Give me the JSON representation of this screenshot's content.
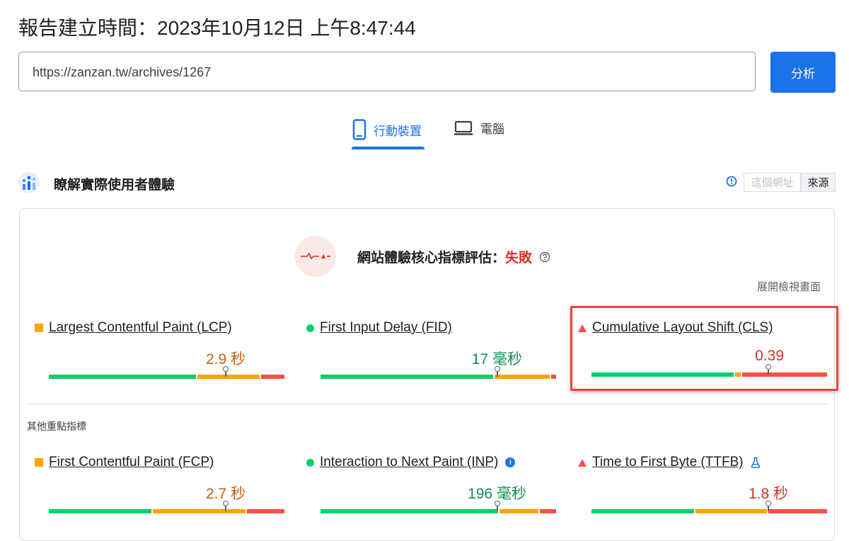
{
  "header": {
    "report_time": "報告建立時間：2023年10月12日 上午8:47:44"
  },
  "url_input": {
    "value": "https://zanzan.tw/archives/1267"
  },
  "analyze_button": {
    "label": "分析"
  },
  "device_tabs": [
    {
      "label": "行動裝置",
      "icon": "smartphone-icon",
      "active": true
    },
    {
      "label": "電腦",
      "icon": "laptop-icon",
      "active": false
    }
  ],
  "crux": {
    "title": "瞭解實際使用者體驗",
    "source_url_label": "這個網址",
    "source_origin_label": "來源"
  },
  "assessment": {
    "label": "網站體驗核心指標評估：",
    "result": "失敗",
    "expand_label": "展開檢視畫面"
  },
  "core_metrics": [
    {
      "name": "Largest Contentful Paint (LCP)",
      "value": "2.9 秒",
      "rating": "needs-improvement"
    },
    {
      "name": "First Input Delay (FID)",
      "value": "17 毫秒",
      "rating": "good"
    },
    {
      "name": "Cumulative Layout Shift (CLS)",
      "value": "0.39",
      "rating": "poor"
    }
  ],
  "other_section": {
    "title": "其他重點指標"
  },
  "other_metrics": [
    {
      "name": "First Contentful Paint (FCP)",
      "value": "2.7 秒",
      "rating": "needs-improvement"
    },
    {
      "name": "Interaction to Next Paint (INP)",
      "value": "196 毫秒",
      "rating": "good",
      "badge": "info-icon"
    },
    {
      "name": "Time to First Byte (TTFB)",
      "value": "1.8 秒",
      "rating": "poor",
      "badge": "flask-icon"
    }
  ],
  "distributions": {
    "lcp": {
      "good": 0.63,
      "needs_improvement": 0.27,
      "poor": 0.1,
      "marker": 0.75
    },
    "fid": {
      "good": 0.74,
      "needs_improvement": 0.24,
      "poor": 0.02,
      "marker": 0.75
    },
    "cls": {
      "good": 0.61,
      "needs_improvement": 0.03,
      "poor": 0.36,
      "marker": 0.75
    },
    "fcp": {
      "good": 0.44,
      "needs_improvement": 0.4,
      "poor": 0.16,
      "marker": 0.75
    },
    "inp": {
      "good": 0.76,
      "needs_improvement": 0.17,
      "poor": 0.07,
      "marker": 0.75
    },
    "ttfb": {
      "good": 0.44,
      "needs_improvement": 0.31,
      "poor": 0.25,
      "marker": 0.75
    }
  },
  "colors": {
    "accent": "#1a73e8",
    "good": "#0cce6b",
    "needs_improvement": "#ffa400",
    "poor": "#ff4e42"
  }
}
